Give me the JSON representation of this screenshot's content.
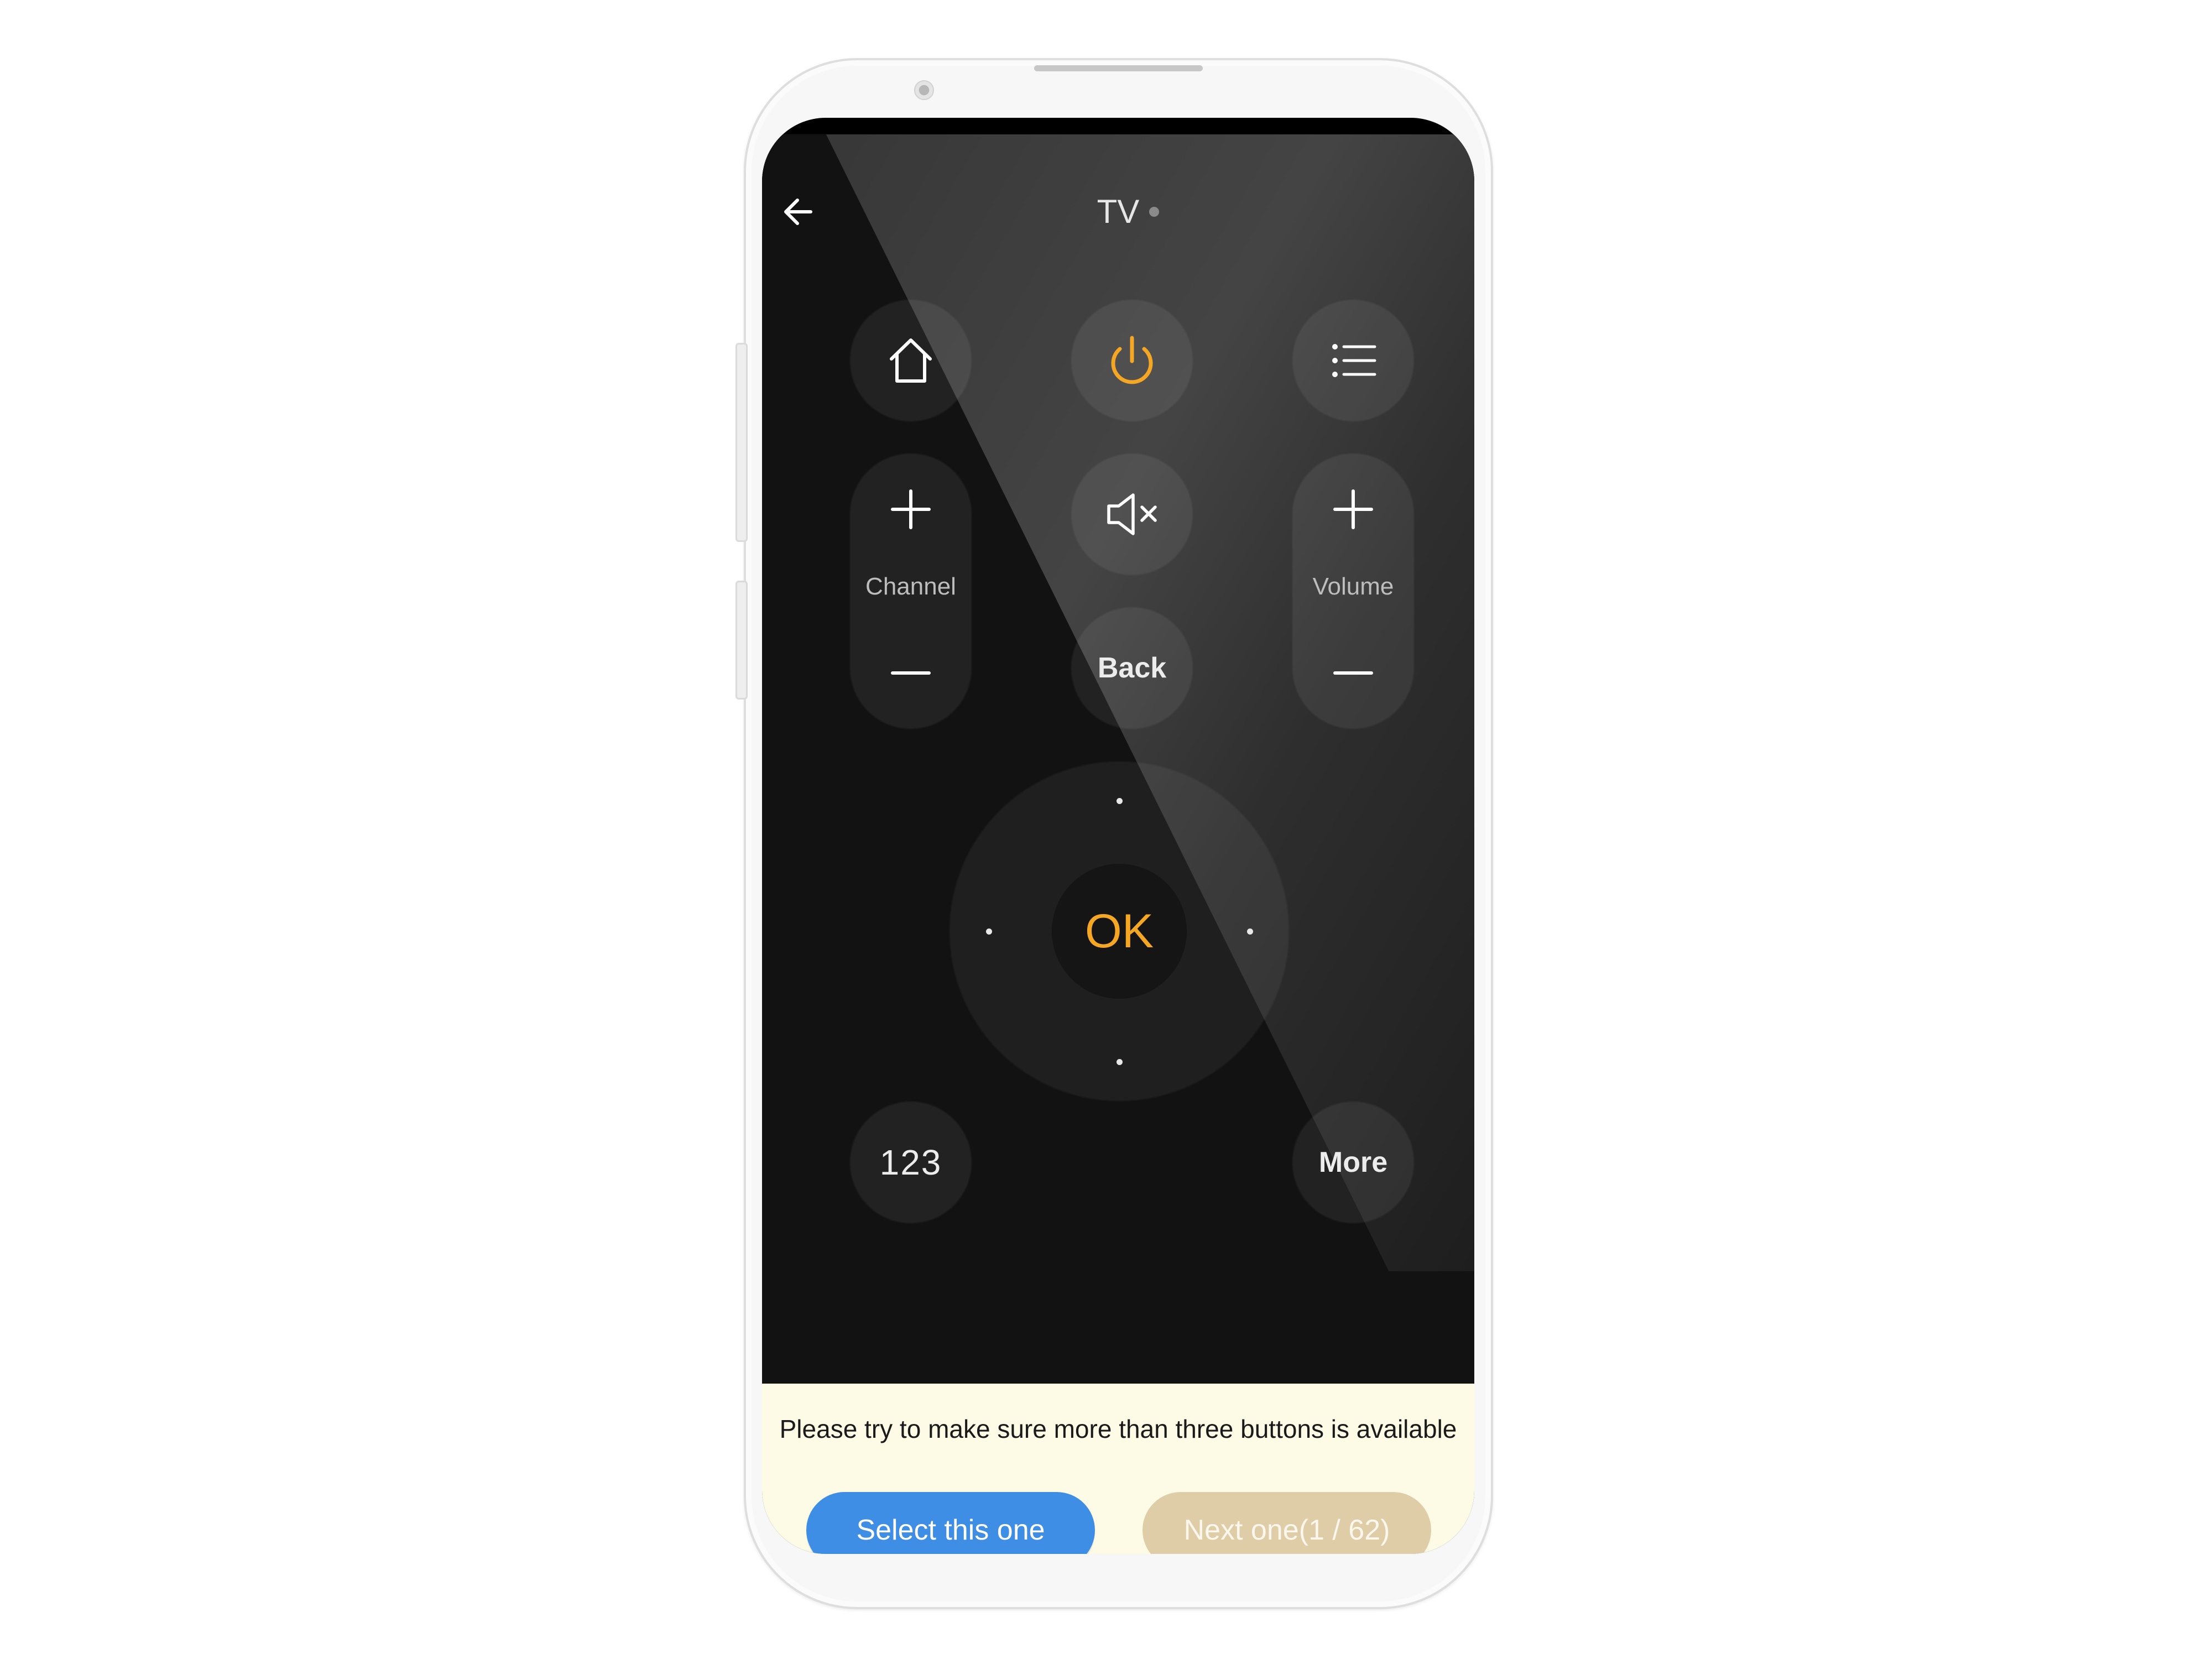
{
  "header": {
    "title": "TV"
  },
  "remote": {
    "channel_label": "Channel",
    "volume_label": "Volume",
    "back_label": "Back",
    "ok_label": "OK",
    "numpad_label": "123",
    "more_label": "More"
  },
  "panel": {
    "message": "Please try to make sure more than three buttons is available",
    "select_label": "Select this one",
    "next_label": "Next one(1 / 62)"
  },
  "colors": {
    "accent": "#f5a623",
    "primary_button": "#3e8ee5",
    "secondary_button": "#dfcda8",
    "panel_background": "#fdfbe6",
    "app_background": "#121212"
  },
  "icons": [
    "back-arrow-icon",
    "home-icon",
    "power-icon",
    "menu-list-icon",
    "mute-icon",
    "plus-icon",
    "minus-icon"
  ]
}
